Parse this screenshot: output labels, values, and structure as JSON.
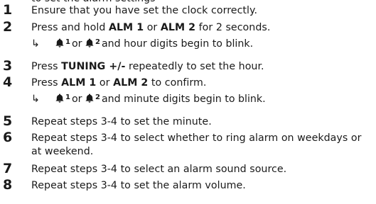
{
  "header_partial": "to set the alarm settings",
  "steps": [
    {
      "num": "1",
      "parts": [
        {
          "t": "Ensure that you have set the clock correctly."
        }
      ]
    },
    {
      "num": "2",
      "parts": [
        {
          "t": "Press and hold "
        },
        {
          "t": "ALM 1",
          "b": true
        },
        {
          "t": " or "
        },
        {
          "t": "ALM 2",
          "b": true
        },
        {
          "t": " for 2 seconds."
        }
      ]
    },
    {
      "num": "3",
      "parts": [
        {
          "t": "Press "
        },
        {
          "t": "TUNING +/-",
          "b": true
        },
        {
          "t": " repeatedly to set the hour."
        }
      ]
    },
    {
      "num": "4",
      "parts": [
        {
          "t": "Press "
        },
        {
          "t": "ALM 1",
          "b": true
        },
        {
          "t": " or "
        },
        {
          "t": "ALM 2",
          "b": true
        },
        {
          "t": " to confirm."
        }
      ]
    },
    {
      "num": "5",
      "parts": [
        {
          "t": "Repeat steps 3-4 to set the minute."
        }
      ]
    },
    {
      "num": "6",
      "parts": [
        {
          "t": "Repeat steps 3-4 to select whether to ring alarm on weekdays or at weekend."
        }
      ]
    },
    {
      "num": "7",
      "parts": [
        {
          "t": "Repeat steps 3-4 to select an alarm sound source."
        }
      ]
    },
    {
      "num": "8",
      "parts": [
        {
          "t": "Repeat steps 3-4 to set the alarm volume."
        }
      ]
    }
  ],
  "results": {
    "after_step_2": {
      "arrow": "↳",
      "bell1_index": "1",
      "or_text": "or",
      "bell2_index": "2",
      "text": "and hour digits begin to blink."
    },
    "after_step_4": {
      "arrow": "↳",
      "bell1_index": "1",
      "or_text": "or",
      "bell2_index": "2",
      "text": "and minute digits begin to blink."
    }
  },
  "icons": {
    "alarm": "alarm-bell-icon",
    "result": "result-arrow-icon"
  }
}
